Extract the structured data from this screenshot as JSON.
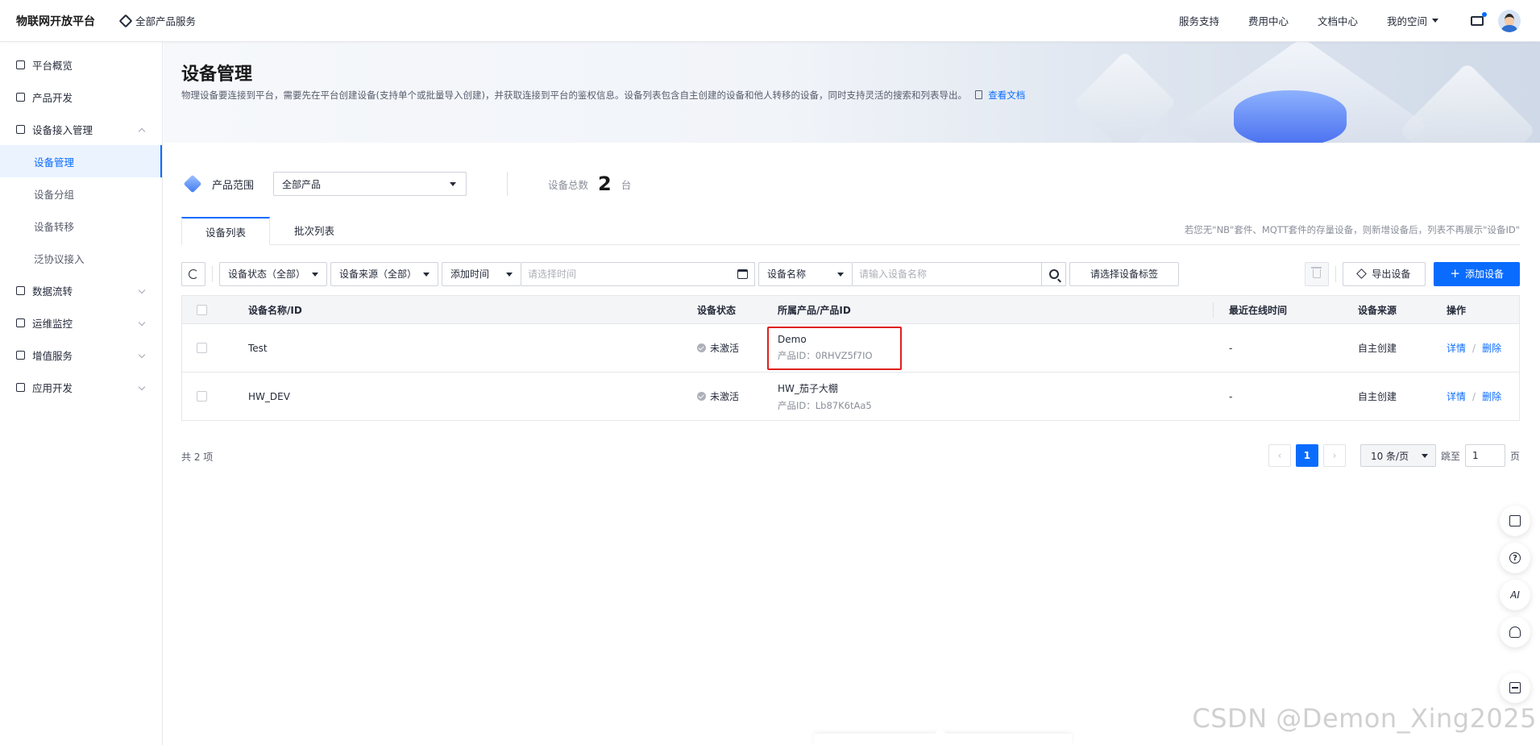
{
  "header": {
    "brand": "物联网开放平台",
    "all_products": "全部产品服务",
    "nav": [
      "服务支持",
      "费用中心",
      "文档中心",
      "我的空间"
    ]
  },
  "sidebar": {
    "items": [
      {
        "label": "平台概览"
      },
      {
        "label": "产品开发"
      },
      {
        "label": "设备接入管理"
      },
      {
        "label": "数据流转"
      },
      {
        "label": "运维监控"
      },
      {
        "label": "增值服务"
      },
      {
        "label": "应用开发"
      }
    ],
    "sub_items": [
      "设备管理",
      "设备分组",
      "设备转移",
      "泛协议接入"
    ]
  },
  "page": {
    "title": "设备管理",
    "description": "物理设备要连接到平台，需要先在平台创建设备(支持单个或批量导入创建)，并获取连接到平台的鉴权信息。设备列表包含自主创建的设备和他人转移的设备，同时支持灵活的搜索和列表导出。",
    "doc_link": "查看文档"
  },
  "range": {
    "label": "产品范围",
    "select_value": "全部产品",
    "total_label": "设备总数",
    "total_value": "2",
    "total_unit": "台"
  },
  "tabs": {
    "items": [
      "设备列表",
      "批次列表"
    ],
    "note": "若您无\"NB\"套件、MQTT套件的存量设备，则新增设备后，列表不再展示\"设备ID\""
  },
  "filters": {
    "status": "设备状态（全部）",
    "source": "设备来源（全部）",
    "time": "添加时间",
    "time_placeholder": "请选择时间",
    "name_field": "设备名称",
    "name_placeholder": "请输入设备名称",
    "tag": "请选择设备标签",
    "export": "导出设备",
    "add": "添加设备"
  },
  "table": {
    "columns": [
      "设备名称/ID",
      "设备状态",
      "所属产品/产品ID",
      "最近在线时间",
      "设备来源",
      "操作"
    ],
    "rows": [
      {
        "name": "Test",
        "status": "未激活",
        "product": "Demo",
        "product_id": "产品ID：0RHVZ5f7IO",
        "last_online": "-",
        "source": "自主创建",
        "op_detail": "详情",
        "op_delete": "删除"
      },
      {
        "name": "HW_DEV",
        "status": "未激活",
        "product": "HW_茄子大棚",
        "product_id": "产品ID：Lb87K6tAa5",
        "last_online": "-",
        "source": "自主创建",
        "op_detail": "详情",
        "op_delete": "删除"
      }
    ]
  },
  "pagination": {
    "total": "共 2 项",
    "current_page": "1",
    "page_size": "10 条/页",
    "jump_label": "跳至",
    "jump_value": "1",
    "page_unit": "页",
    "prev": "‹",
    "next": "›"
  },
  "float_tools": {
    "ai": "AI"
  },
  "watermark": "CSDN @Demon_Xing2025",
  "colors": {
    "accent": "#0a6cff",
    "highlight": "#e0201c"
  }
}
